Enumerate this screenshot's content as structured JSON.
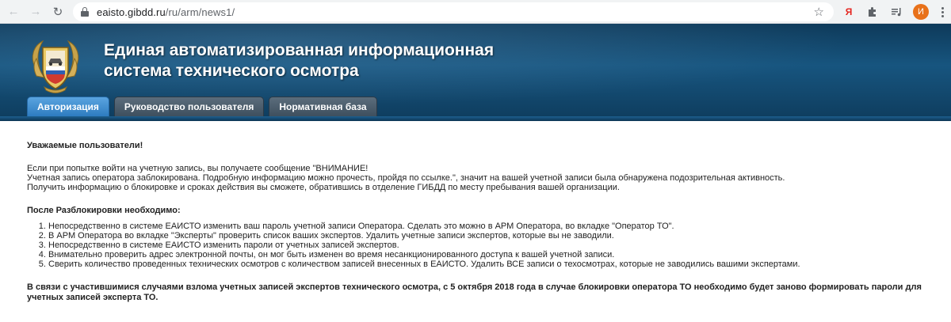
{
  "browser": {
    "back_icon": "arrow-left",
    "forward_icon": "arrow-right",
    "reload_icon": "reload",
    "url_host": "eaisto.gibdd.ru",
    "url_path": "/ru/arm/news1/",
    "extensions": [
      "Я",
      "puzzle",
      "playlist"
    ],
    "avatar_letter": "И",
    "avatar_color": "#e8711a"
  },
  "site": {
    "title_line1": "Единая автоматизированная информационная",
    "title_line2": "система технического осмотра",
    "tabs": [
      {
        "label": "Авторизация",
        "active": true
      },
      {
        "label": "Руководство пользователя",
        "active": false
      },
      {
        "label": "Нормативная база",
        "active": false
      }
    ]
  },
  "content": {
    "greeting": "Уважаемые пользователи!",
    "paragraph": [
      "Если при попытке войти на учетную запись, вы получаете сообщение \"ВНИМАНИЕ!",
      "Учетная запись оператора заблокирована. Подробную информацию можно прочесть, пройдя по ссылке.\", значит на вашей учетной записи была обнаружена подозрительная активность.",
      "Получить информацию о блокировке и сроках действия вы сможете, обратившись в отделение ГИБДД по месту пребывания вашей организации."
    ],
    "subhead": "После Разблокировки необходимо:",
    "steps": [
      "Непосредственно в системе ЕАИСТО изменить ваш пароль учетной записи Оператора. Сделать это можно в АРМ Оператора, во вкладке \"Оператор ТО\".",
      "В АРМ Оператора во вкладке \"Эксперты\" проверить список ваших экспертов. Удалить учетные записи экспертов, которые вы не заводили.",
      "Непосредственно в системе ЕАИСТО изменить пароли от учетных записей экспертов.",
      "Внимательно проверить адрес электронной почты, он мог быть изменен во время несанкционированного доступа к вашей учетной записи.",
      "Сверить количество проведенных технических осмотров с количеством записей внесенных в ЕАИСТО. Удалить ВСЕ записи о техосмотрах, которые не заводились вашими экспертами."
    ],
    "final_notice": "В связи с участившимися случаями взлома учетных записей экспертов технического осмотра, с 5 октября 2018 года в случае блокировки оператора ТО необходимо будет заново формировать пароли для учетных записей эксперта ТО."
  }
}
